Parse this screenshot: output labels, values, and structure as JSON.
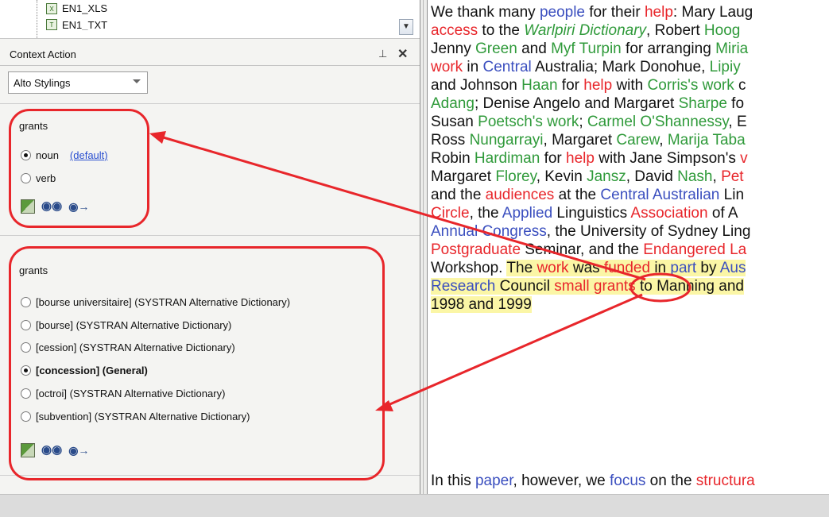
{
  "tree": {
    "items": [
      "EN1_XLS",
      "EN1_TXT"
    ]
  },
  "panel": {
    "title": "Context Action",
    "pin_glyph": "⊥",
    "close_glyph": "✕"
  },
  "styling": {
    "selected": "Alto Stylings"
  },
  "section1": {
    "word": "grants",
    "options": [
      {
        "label": "noun",
        "checked": true
      },
      {
        "label": "verb",
        "checked": false
      }
    ],
    "default_label": "(default)"
  },
  "section2": {
    "word": "grants",
    "options": [
      {
        "label": "[bourse universitaire] (SYSTRAN Alternative Dictionary)",
        "checked": false
      },
      {
        "label": "[bourse] (SYSTRAN Alternative Dictionary)",
        "checked": false
      },
      {
        "label": "[cession] (SYSTRAN Alternative Dictionary)",
        "checked": false
      },
      {
        "label": "[concession] (General)",
        "checked": true
      },
      {
        "label": "[octroi] (SYSTRAN Alternative Dictionary)",
        "checked": false
      },
      {
        "label": "[subvention] (SYSTRAN Alternative Dictionary)",
        "checked": false
      }
    ]
  },
  "icons": [
    "edit-dictionary-icon",
    "binoculars-icon",
    "find-next-icon"
  ],
  "colors": {
    "annotation_red": "#e8262b",
    "word_red": "#e8262b",
    "word_blue": "#3b4fbf",
    "word_green": "#2f9a3a",
    "highlight": "#fbf6a6"
  },
  "document": {
    "l1a": "We thank many ",
    "l1b": "people",
    "l1c": " for their ",
    "l1d": "help",
    "l1e": ": Mary Laug",
    "l2a": "access",
    "l2b": " to the ",
    "l2c": "Warlpiri Dictionary",
    "l2d": ", Robert ",
    "l2e": "Hoog",
    "l3a": "Jenny ",
    "l3b": "Green",
    "l3c": " and ",
    "l3d": "Myf Turpin",
    "l3e": " for arranging ",
    "l3f": "Miria",
    "l4a": "work",
    "l4b": " in ",
    "l4c": "Central",
    "l4d": " Australia; Mark Donohue, ",
    "l4e": "Lipiy",
    "l5a": "and Johnson ",
    "l5b": "Haan",
    "l5c": " for ",
    "l5d": "help",
    "l5e": " with ",
    "l5f": "Corris's work",
    "l5g": " c",
    "l6a": "Adang",
    "l6b": "; Denise Angelo and Margaret ",
    "l6c": "Sharpe",
    "l6d": " fo",
    "l7a": "Susan ",
    "l7b": "Poetsch's work",
    "l7c": "; ",
    "l7d": "Carmel O'Shannessy",
    "l7e": ", E",
    "l8a": "Ross ",
    "l8b": "Nungarrayi",
    "l8c": ", Margaret ",
    "l8d": "Carew",
    "l8e": ", ",
    "l8f": "Marija Taba",
    "l9a": "Robin ",
    "l9b": "Hardiman",
    "l9c": " for ",
    "l9d": "help",
    "l9e": " with Jane Simpson's ",
    "l9f": "v",
    "l10a": "Margaret ",
    "l10b": "Florey",
    "l10c": ", Kevin ",
    "l10d": "Jansz",
    "l10e": ", David ",
    "l10f": "Nash",
    "l10g": ", ",
    "l10h": "Pet",
    "l11a": "and the ",
    "l11b": "audiences",
    "l11c": " at the ",
    "l11d": "Central Australian",
    "l11e": " Lin",
    "l12a": "Circle",
    "l12b": ", the ",
    "l12c": "Applied",
    "l12d": " Linguistics ",
    "l12e": "Association",
    "l12f": " of A",
    "l13a": "Annual Congress",
    "l13b": ", the University of Sydney Ling",
    "l14a": "Postgraduate",
    "l14b": " Seminar, and the ",
    "l14c": "Endangered La",
    "l15a": "Workshop. ",
    "l15b": "The ",
    "l15c": "work",
    "l15d": " was ",
    "l15e": "funded",
    "l15f": " in ",
    "l15g": "part",
    "l15h": " by ",
    "l15i": "Aus",
    "l16a": "Research",
    "l16b": " Council ",
    "l16c": "small",
    "l16d": " ",
    "l16e": "grants",
    "l16f": " to Manning and",
    "l17a": "1998 and 1999",
    "l18a": "In this ",
    "l18b": "paper",
    "l18c": ", however, we ",
    "l18d": "focus",
    "l18e": " on the ",
    "l18f": "structura"
  }
}
